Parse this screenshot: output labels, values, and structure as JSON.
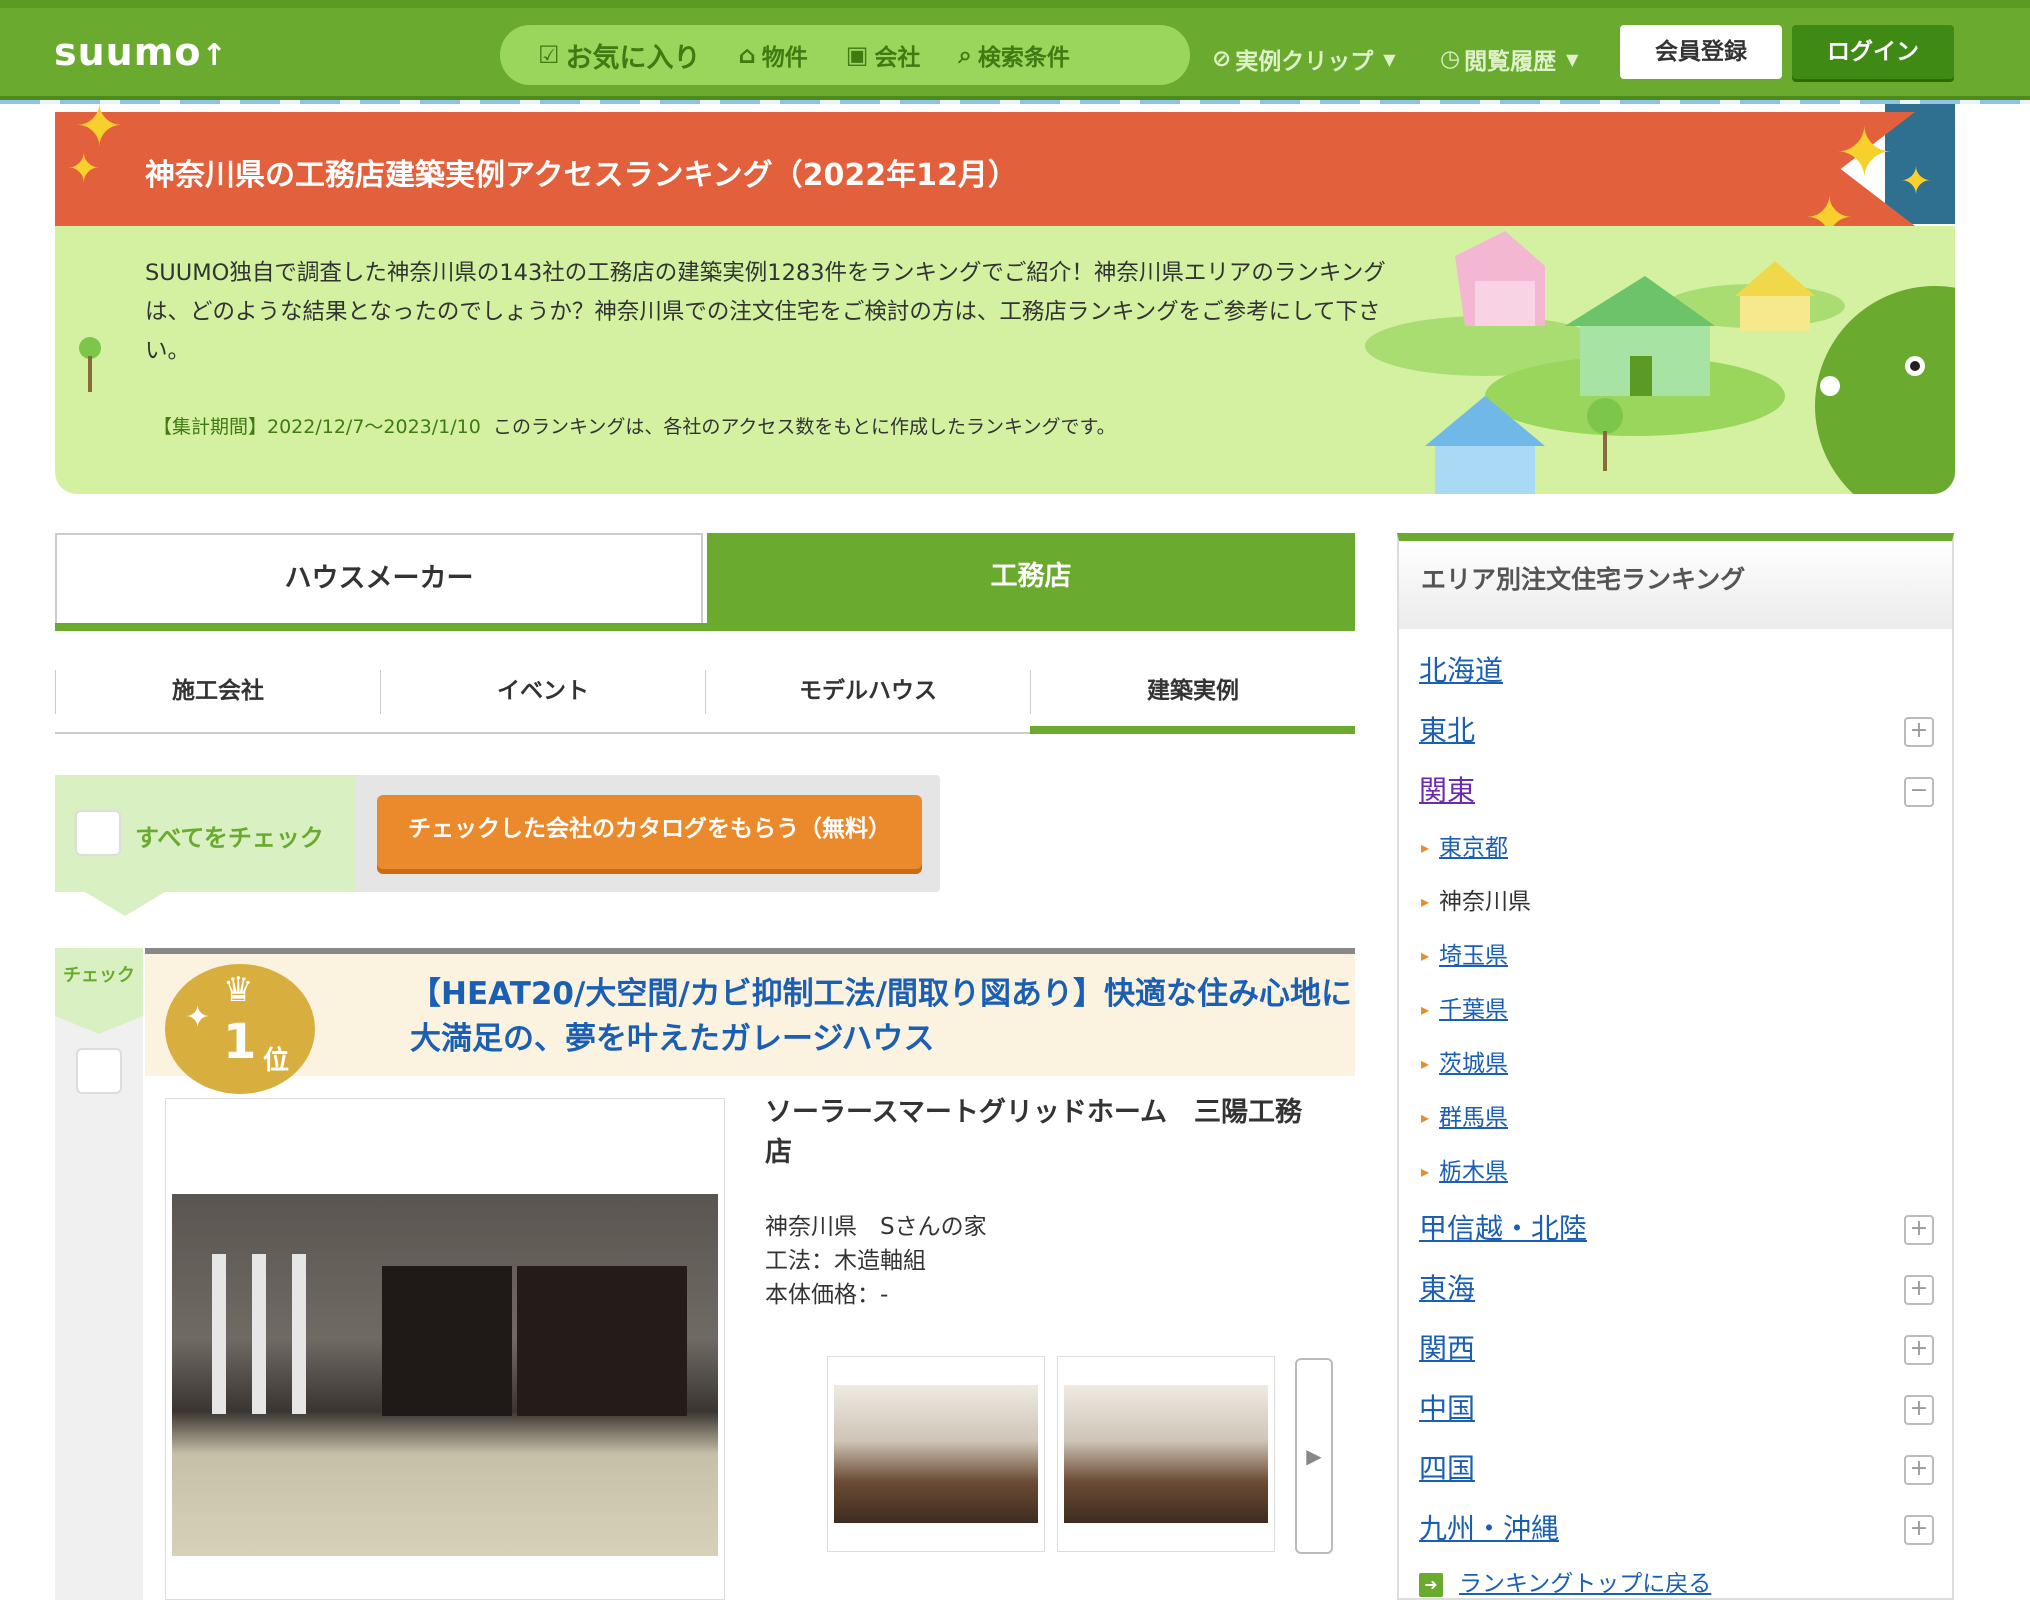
{
  "header": {
    "logo": "suumo",
    "nav": {
      "favorites": "お気に入り",
      "property": "物件",
      "company": "会社",
      "search_conditions": "検索条件"
    },
    "example_clip": "実例クリップ",
    "history": "閲覧履歴",
    "register": "会員登録",
    "login": "ログイン"
  },
  "banner": {
    "title": "神奈川県の工務店建築実例アクセスランキング（2022年12月）",
    "description": "SUUMO独自で調査した神奈川県の143社の工務店の建築実例1283件をランキングでご紹介！神奈川県エリアのランキングは、どのような結果となったのでしょうか？神奈川県での注文住宅をご検討の方は、工務店ランキングをご参考にして下さい。",
    "period_label": "【集計期間】2022/12/7〜2023/1/10",
    "period_note": "このランキングは、各社のアクセス数をもとに作成したランキングです。"
  },
  "tabs": {
    "house_maker": "ハウスメーカー",
    "koumuten": "工務店"
  },
  "subtabs": [
    "施工会社",
    "イベント",
    "モデルハウス",
    "建築実例"
  ],
  "check_all": {
    "label": "すべてをチェック",
    "catalog_button": "チェックした会社のカタログをもらう（無料）"
  },
  "ranking": [
    {
      "check_label": "チェック",
      "rank": "1",
      "rank_suffix": "位",
      "title": "【HEAT20/大空間/カビ抑制工法/間取り図あり】快適な住み心地に大満足の、夢を叶えたガレージハウス",
      "company": "ソーラースマートグリッドホーム　三陽工務店",
      "location": "神奈川県　Sさんの家",
      "method": "工法：木造軸組",
      "price": "本体価格：-"
    }
  ],
  "sidebar": {
    "title": "エリア別注文住宅ランキング",
    "regions": [
      {
        "name": "北海道"
      },
      {
        "name": "東北"
      },
      {
        "name": "関東"
      },
      {
        "name": "甲信越・北陸"
      },
      {
        "name": "東海"
      },
      {
        "name": "関西"
      },
      {
        "name": "中国"
      },
      {
        "name": "四国"
      },
      {
        "name": "九州・沖縄"
      }
    ],
    "kanto_prefs": [
      "東京都",
      "神奈川県",
      "埼玉県",
      "千葉県",
      "茨城県",
      "群馬県",
      "栃木県"
    ],
    "back_link": "ランキングトップに戻る"
  },
  "colors": {
    "brand_green": "#6aaa2e",
    "ribbon_orange": "#e2603b",
    "catalog_orange": "#ea8a2c",
    "link_blue": "#1a5fb4"
  }
}
